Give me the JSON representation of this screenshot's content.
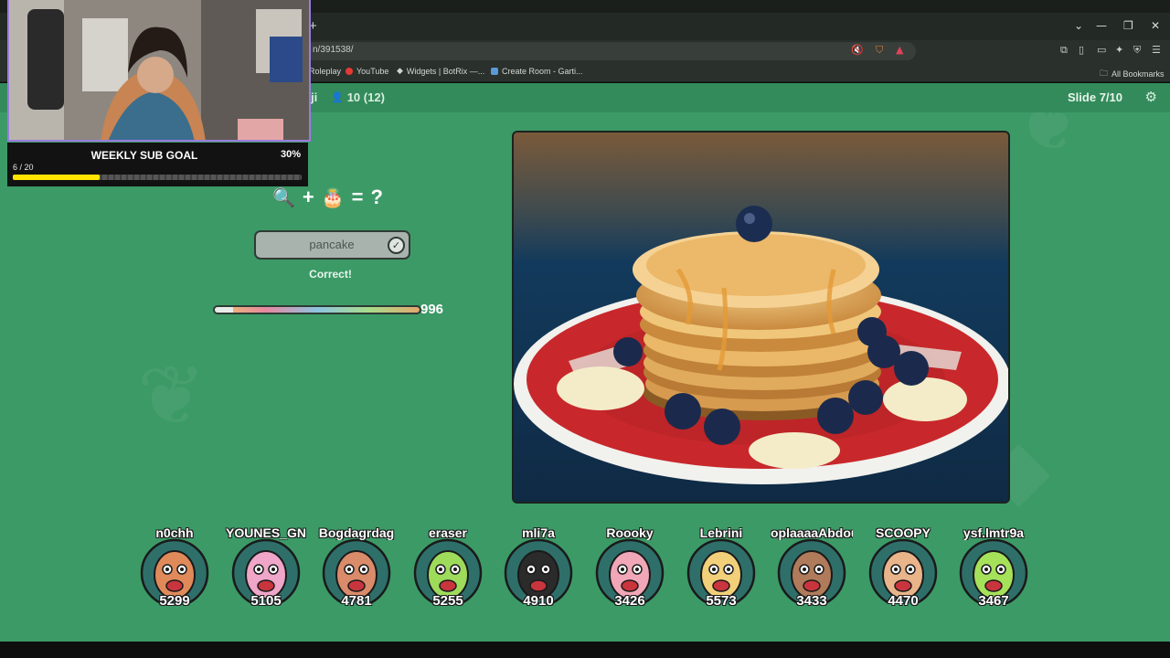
{
  "browser": {
    "url": "n/391538/",
    "bookmarks": [
      {
        "label": "Roleplay",
        "color": "#c98a57"
      },
      {
        "label": "YouTube",
        "color": "#e53935"
      },
      {
        "label": "Widgets | BotRix —...",
        "color": "#cfd3d6"
      },
      {
        "label": "Create Room - Garti...",
        "color": "#5a9bd6"
      }
    ],
    "all_bookmarks_label": "All Bookmarks"
  },
  "game": {
    "room_fragment": "ji",
    "players_count": "10 (12)",
    "slide": "Slide 7/10",
    "equation": {
      "plus": "+",
      "equals": "=",
      "unknown": "?"
    },
    "answer": "pancake",
    "answer_status": "Correct!",
    "timer_value": "996",
    "timer_fraction": 0.92,
    "players": [
      {
        "name": "n0chh",
        "score": "5299",
        "color": "#e08a5a"
      },
      {
        "name": "YOUNES_GN",
        "score": "5105",
        "color": "#f0a6c8"
      },
      {
        "name": "Bogdagrdag",
        "score": "4781",
        "color": "#d98b6a"
      },
      {
        "name": "eraser",
        "score": "5255",
        "color": "#9edb5b"
      },
      {
        "name": "mli7a",
        "score": "4910",
        "color": "#2b2b2b"
      },
      {
        "name": "Roooky",
        "score": "3426",
        "color": "#f1a7b7"
      },
      {
        "name": "Lebrini",
        "score": "5573",
        "color": "#f2d07a"
      },
      {
        "name": "oplaaaaAbdou",
        "score": "3433",
        "color": "#b07b5a"
      },
      {
        "name": "SCOOPY",
        "score": "4470",
        "color": "#e9b48a"
      },
      {
        "name": "ysf.lmtr9a",
        "score": "3467",
        "color": "#a6e15a"
      }
    ]
  },
  "stream_overlay": {
    "goal_title": "WEEKLY SUB GOAL",
    "goal_percent": "30%",
    "goal_count": "6 / 20",
    "goal_fraction": 0.3
  },
  "colors": {
    "page_bg": "#3c9a67",
    "goal_fill": "#ffe400",
    "cam_border": "#9b7be0"
  }
}
